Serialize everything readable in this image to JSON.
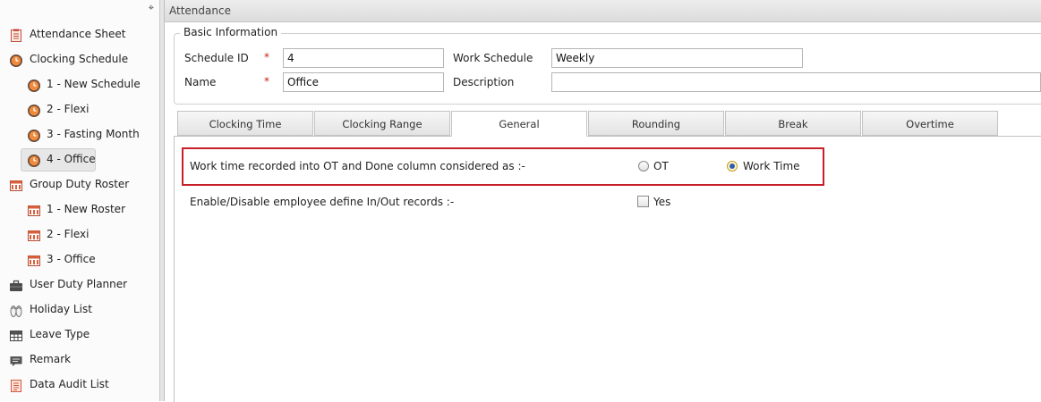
{
  "sidebar": {
    "pin_glyph": "⌖",
    "items": [
      {
        "label": "Attendance Sheet",
        "icon": "attendance-sheet-icon",
        "level": 0
      },
      {
        "label": "Clocking Schedule",
        "icon": "clock-icon",
        "level": 0
      },
      {
        "label": "1 - New Schedule",
        "icon": "clock-icon",
        "level": 1
      },
      {
        "label": "2 - Flexi",
        "icon": "clock-icon",
        "level": 1
      },
      {
        "label": "3 - Fasting Month",
        "icon": "clock-icon",
        "level": 1
      },
      {
        "label": "4 - Office",
        "icon": "clock-icon",
        "level": 1,
        "selected": true
      },
      {
        "label": "Group Duty Roster",
        "icon": "roster-icon",
        "level": 0
      },
      {
        "label": "1 - New Roster",
        "icon": "roster-icon",
        "level": 1
      },
      {
        "label": "2 - Flexi",
        "icon": "roster-icon",
        "level": 1
      },
      {
        "label": "3 - Office",
        "icon": "roster-icon",
        "level": 1
      },
      {
        "label": "User Duty Planner",
        "icon": "briefcase-icon",
        "level": 0
      },
      {
        "label": "Holiday List",
        "icon": "sandals-icon",
        "level": 0
      },
      {
        "label": "Leave Type",
        "icon": "grid-table-icon",
        "level": 0
      },
      {
        "label": "Remark",
        "icon": "comment-icon",
        "level": 0
      },
      {
        "label": "Data Audit List",
        "icon": "audit-list-icon",
        "level": 0
      }
    ]
  },
  "header": {
    "title": "Attendance"
  },
  "basic_info": {
    "legend": "Basic Information",
    "schedule_id_label": "Schedule ID",
    "schedule_id_value": "4",
    "name_label": "Name",
    "name_value": "Office",
    "required_mark": "*",
    "work_schedule_label": "Work Schedule",
    "work_schedule_value": "Weekly",
    "description_label": "Description",
    "description_value": ""
  },
  "tabs": [
    {
      "label": "Clocking Time"
    },
    {
      "label": "Clocking Range"
    },
    {
      "label": "General",
      "active": true
    },
    {
      "label": "Rounding"
    },
    {
      "label": "Break"
    },
    {
      "label": "Overtime"
    }
  ],
  "general": {
    "ot_question": "Work time recorded into OT and Done column considered as :-",
    "ot_option": "OT",
    "work_time_option": "Work Time",
    "selected_option": "Work Time",
    "enable_question": "Enable/Disable employee define In/Out records :-",
    "yes_label": "Yes",
    "yes_checked": false
  },
  "colors": {
    "highlight_border": "#c8202a",
    "required_star": "#d02020",
    "radio_selected": "#2e5fa6"
  }
}
